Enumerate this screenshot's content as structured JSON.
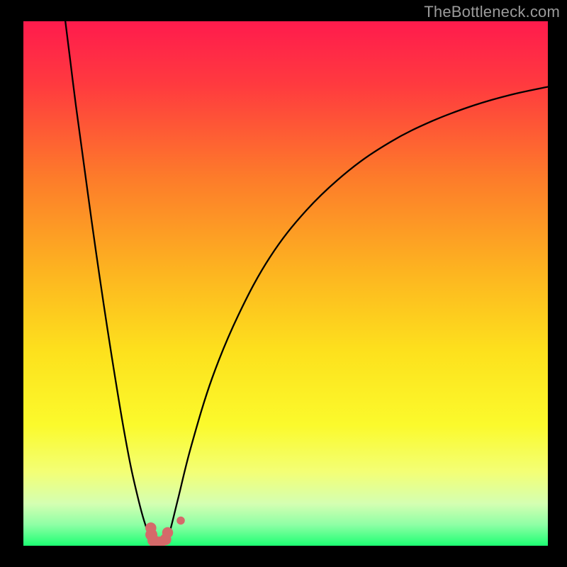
{
  "watermark": "TheBottleneck.com",
  "chart_data": {
    "type": "line",
    "title": "",
    "xlabel": "",
    "ylabel": "",
    "xlim": [
      0,
      100
    ],
    "ylim": [
      0,
      100
    ],
    "grid": false,
    "legend": false,
    "background_gradient": {
      "stops": [
        {
          "offset": 0.0,
          "color": "#ff1b4d"
        },
        {
          "offset": 0.12,
          "color": "#ff3a3f"
        },
        {
          "offset": 0.3,
          "color": "#fd7c2a"
        },
        {
          "offset": 0.48,
          "color": "#fdb520"
        },
        {
          "offset": 0.63,
          "color": "#fde11d"
        },
        {
          "offset": 0.77,
          "color": "#fbfa2c"
        },
        {
          "offset": 0.86,
          "color": "#f3ff76"
        },
        {
          "offset": 0.92,
          "color": "#d4ffb2"
        },
        {
          "offset": 0.96,
          "color": "#8effa5"
        },
        {
          "offset": 1.0,
          "color": "#1dff73"
        }
      ]
    },
    "series": [
      {
        "name": "left-curve",
        "x": [
          8.0,
          9.0,
          10.0,
          11.5,
          13.0,
          14.5,
          16.0,
          17.5,
          19.0,
          20.5,
          22.0,
          23.0,
          23.8,
          24.4,
          24.8
        ],
        "y": [
          100,
          92,
          84,
          73,
          62,
          51.5,
          41.5,
          32,
          23,
          15,
          8.5,
          4.8,
          2.5,
          1.3,
          0.8
        ]
      },
      {
        "name": "right-curve",
        "x": [
          27.2,
          28.0,
          29.5,
          32.0,
          36.0,
          41.0,
          47.0,
          54.0,
          62.0,
          70.0,
          78.0,
          86.0,
          93.0,
          100.0
        ],
        "y": [
          0.8,
          3.0,
          9.0,
          19.0,
          32.0,
          44.0,
          55.0,
          64.0,
          71.5,
          77.0,
          81.0,
          84.0,
          86.0,
          87.5
        ]
      }
    ],
    "markers": [
      {
        "name": "blob-top-left",
        "cx": 24.3,
        "cy": 3.4,
        "r": 1.05,
        "color": "#d56a6a"
      },
      {
        "name": "blob-mid-left",
        "cx": 24.4,
        "cy": 2.1,
        "r": 1.15,
        "color": "#d56a6a"
      },
      {
        "name": "blob-bot-left",
        "cx": 24.8,
        "cy": 1.0,
        "r": 1.15,
        "color": "#d56a6a"
      },
      {
        "name": "blob-bot-mid",
        "cx": 26.0,
        "cy": 0.6,
        "r": 1.15,
        "color": "#d56a6a"
      },
      {
        "name": "blob-bot-right",
        "cx": 27.1,
        "cy": 1.2,
        "r": 1.1,
        "color": "#d56a6a"
      },
      {
        "name": "blob-right-up",
        "cx": 27.5,
        "cy": 2.5,
        "r": 1.05,
        "color": "#d56a6a"
      },
      {
        "name": "blob-outlier",
        "cx": 30.0,
        "cy": 4.8,
        "r": 0.78,
        "color": "#d56a6a"
      }
    ]
  }
}
